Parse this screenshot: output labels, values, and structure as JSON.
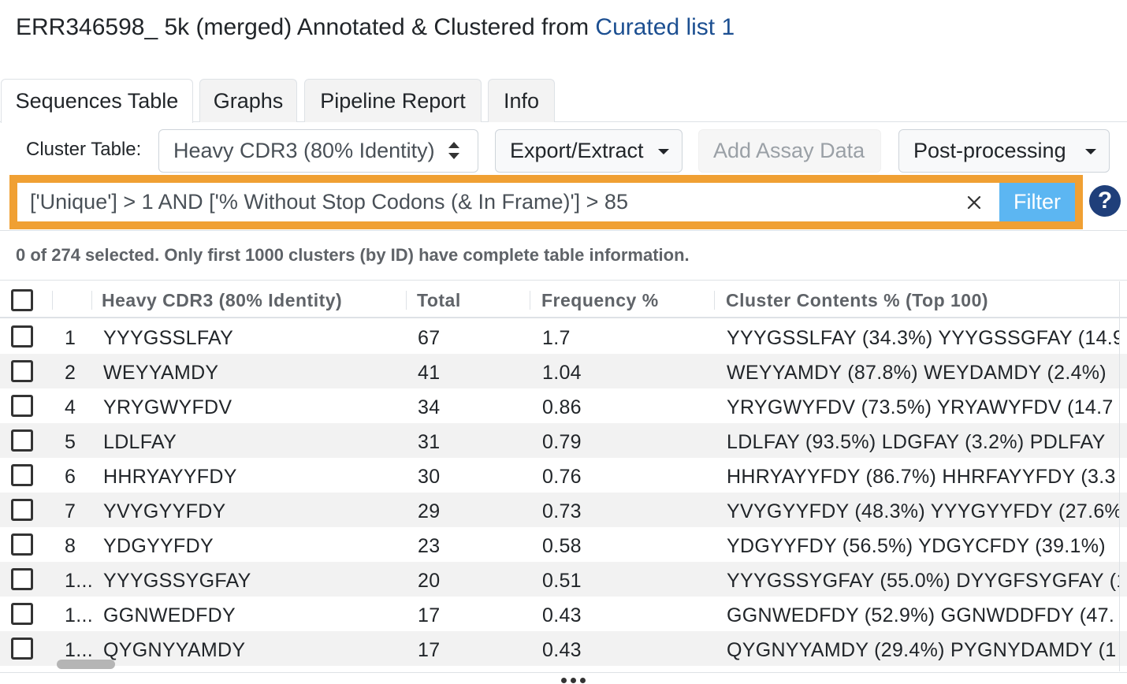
{
  "header": {
    "title_prefix": "ERR346598_ 5k (merged) Annotated & Clustered from",
    "title_link": "Curated list 1"
  },
  "tabs": [
    {
      "label": "Sequences Table",
      "active": true
    },
    {
      "label": "Graphs",
      "active": false
    },
    {
      "label": "Pipeline Report",
      "active": false
    },
    {
      "label": "Info",
      "active": false
    }
  ],
  "toolbar": {
    "cluster_label": "Cluster Table:",
    "cluster_select_value": "Heavy CDR3 (80% Identity)",
    "export_label": "Export/Extract",
    "assay_label": "Add Assay Data",
    "postproc_label": "Post-processing"
  },
  "filter": {
    "query": "['Unique'] > 1 AND ['% Without Stop Codons (& In Frame)'] > 85",
    "button_label": "Filter",
    "help": "?"
  },
  "status": "0 of 274 selected. Only first 1000 clusters (by ID) have complete table information.",
  "table": {
    "columns": [
      "Heavy CDR3 (80% Identity)",
      "Total",
      "Frequency %",
      "Cluster Contents % (Top 100)"
    ],
    "rows": [
      {
        "id": "1",
        "cdr3": "YYYGSSLFAY",
        "total": "67",
        "freq": "1.7",
        "contents": "YYYGSSLFAY (34.3%) YYYGSSGFAY (14.9"
      },
      {
        "id": "2",
        "cdr3": "WEYYAMDY",
        "total": "41",
        "freq": "1.04",
        "contents": "WEYYAMDY (87.8%) WEYDAMDY (2.4%)"
      },
      {
        "id": "4",
        "cdr3": "YRYGWYFDV",
        "total": "34",
        "freq": "0.86",
        "contents": "YRYGWYFDV (73.5%) YRYAWYFDV (14.7"
      },
      {
        "id": "5",
        "cdr3": "LDLFAY",
        "total": "31",
        "freq": "0.79",
        "contents": "LDLFAY (93.5%) LDGFAY (3.2%) PDLFAY"
      },
      {
        "id": "6",
        "cdr3": "HHRYAYYFDY",
        "total": "30",
        "freq": "0.76",
        "contents": "HHRYAYYFDY (86.7%) HHRFAYYFDY (3.3"
      },
      {
        "id": "7",
        "cdr3": "YVYGYYFDY",
        "total": "29",
        "freq": "0.73",
        "contents": "YVYGYYFDY (48.3%) YYYGYYFDY (27.6%"
      },
      {
        "id": "8",
        "cdr3": "YDGYYFDY",
        "total": "23",
        "freq": "0.58",
        "contents": "YDGYYFDY (56.5%) YDGYCFDY (39.1%)"
      },
      {
        "id": "1...",
        "cdr3": "YYYGSSYGFAY",
        "total": "20",
        "freq": "0.51",
        "contents": "YYYGSSYGFAY (55.0%) DYYGFSYGFAY (1"
      },
      {
        "id": "1...",
        "cdr3": "GGNWEDFDY",
        "total": "17",
        "freq": "0.43",
        "contents": "GGNWEDFDY (52.9%) GGNWDDFDY (47."
      },
      {
        "id": "1...",
        "cdr3": "QYGNYYAMDY",
        "total": "17",
        "freq": "0.43",
        "contents": "QYGNYYAMDY (29.4%) PYGNYDAMDY (1"
      }
    ]
  }
}
